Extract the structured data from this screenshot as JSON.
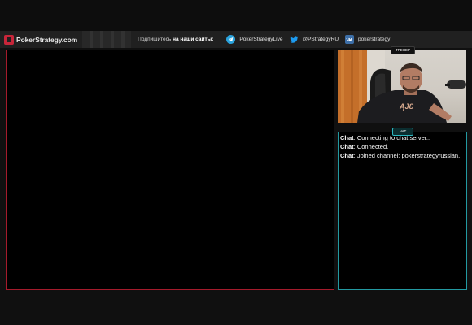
{
  "header": {
    "brand": "PokerStrategy.com",
    "follow_prefix": "Подпишитесь ",
    "follow_bold": "на наши сайты:",
    "socials": [
      {
        "icon": "telegram-icon",
        "label": "PokerStrategyLive",
        "color": "#2aa3dd"
      },
      {
        "icon": "twitter-icon",
        "label": "@PStrategyRU",
        "color": "#1d9bf0"
      },
      {
        "icon": "vk-icon",
        "label": "pokerstrategy",
        "color": "#3d6fa8"
      }
    ]
  },
  "webcam": {
    "label": "ТРЕНЕР",
    "shirt_text": "ĄJƐ"
  },
  "chat": {
    "label": "ЧАТ",
    "lines": [
      {
        "who": "Chat",
        "text": ": Connecting to chat server.."
      },
      {
        "who": "Chat",
        "text": ": Connected."
      },
      {
        "who": "Chat",
        "text": ": Joined channel: pokerstrategyrussian."
      }
    ]
  },
  "colors": {
    "accent_red": "#a51b2c",
    "accent_teal": "#239aa2",
    "background": "#101010"
  }
}
